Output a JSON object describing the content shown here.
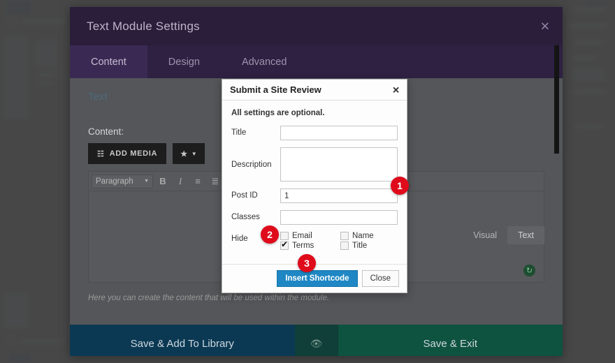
{
  "builder": {
    "title": "Text Module Settings",
    "close_icon": "close-icon",
    "tabs": [
      {
        "label": "Content",
        "active": true
      },
      {
        "label": "Design",
        "active": false
      },
      {
        "label": "Advanced",
        "active": false
      }
    ],
    "section_title": "Text",
    "content_label": "Content:",
    "add_media_label": "ADD MEDIA",
    "add_media_icon": "media-icon",
    "star_icon": "star-icon",
    "star_caret_icon": "caret-down-icon",
    "toolbar": {
      "paragraph_label": "Paragraph",
      "paragraph_caret": "caret-down-icon",
      "bold_label": "B",
      "italic_label": "I",
      "ul_icon": "bullet-list-icon",
      "ol_icon": "numbered-list-icon",
      "quote_label": "“"
    },
    "editor_badge_icon": "grammar-check-icon",
    "view_tabs": [
      {
        "label": "Visual",
        "active": false
      },
      {
        "label": "Text",
        "active": true
      }
    ],
    "help_text": "Here you can create the content that will be used within the module.",
    "footer": {
      "save_library_label": "Save & Add To Library",
      "preview_icon": "eye-icon",
      "save_exit_label": "Save & Exit"
    }
  },
  "dialog": {
    "title": "Submit a Site Review",
    "close_icon": "close-icon",
    "note": "All settings are optional.",
    "fields": [
      {
        "label": "Title",
        "value": "",
        "type": "text"
      },
      {
        "label": "Description",
        "value": "",
        "type": "textarea"
      },
      {
        "label": "Post ID",
        "value": "1",
        "type": "text"
      },
      {
        "label": "Classes",
        "value": "",
        "type": "text"
      }
    ],
    "hide_label": "Hide",
    "hide_options": [
      {
        "label": "Email",
        "checked": false
      },
      {
        "label": "Name",
        "checked": false
      },
      {
        "label": "Terms",
        "checked": true
      },
      {
        "label": "Title",
        "checked": false
      }
    ],
    "insert_label": "Insert Shortcode",
    "close_label": "Close"
  },
  "badges": [
    {
      "number": "1"
    },
    {
      "number": "2"
    },
    {
      "number": "3"
    }
  ],
  "colors": {
    "header_purple": "#2b1e3b",
    "tab_purple": "#2e2142",
    "active_tab_purple": "#3a2a53",
    "badge_red": "#df0b1b",
    "primary_blue": "#1f87c4",
    "footer_blue": "#0b3954",
    "footer_green": "#0e5240"
  }
}
